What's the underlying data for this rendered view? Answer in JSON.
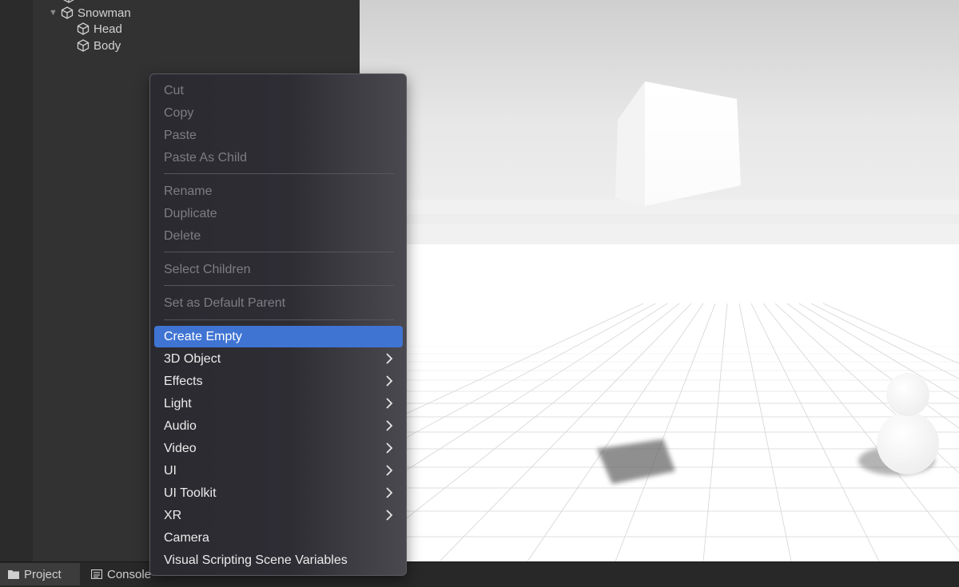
{
  "hierarchy": {
    "items": [
      {
        "label": "Snowman",
        "expanded": true,
        "icon": "cube-icon"
      },
      {
        "label": "Head",
        "icon": "cube-icon"
      },
      {
        "label": "Body",
        "icon": "cube-icon"
      }
    ]
  },
  "bottom_tabs": [
    {
      "label": "Project",
      "icon": "folder-icon",
      "active": true
    },
    {
      "label": "Console",
      "icon": "console-icon",
      "active": false
    }
  ],
  "context_menu": {
    "cut": "Cut",
    "copy": "Copy",
    "paste": "Paste",
    "paste_as_child": "Paste As Child",
    "rename": "Rename",
    "duplicate": "Duplicate",
    "delete": "Delete",
    "select_children": "Select Children",
    "set_default_parent": "Set as Default Parent",
    "create_empty": "Create Empty",
    "object_3d": "3D Object",
    "effects": "Effects",
    "light": "Light",
    "audio": "Audio",
    "video": "Video",
    "ui": "UI",
    "ui_toolkit": "UI Toolkit",
    "xr": "XR",
    "camera": "Camera",
    "visual_scripting": "Visual Scripting Scene Variables"
  },
  "colors": {
    "selection": "#3f74d3",
    "menu_background": "#2e2d34",
    "panel_background": "#323232"
  }
}
